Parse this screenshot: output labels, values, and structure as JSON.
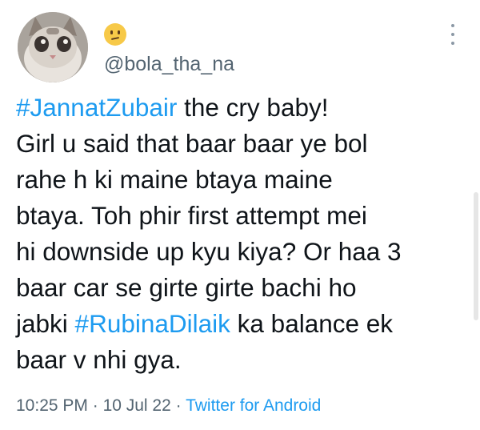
{
  "author": {
    "display_emoji": "😕",
    "handle": "@bola_tha_na"
  },
  "tweet": {
    "lines": [
      [
        {
          "text": "#JannatZubair",
          "hashtag": true
        },
        {
          "text": " the cry baby!",
          "hashtag": false
        }
      ],
      [
        {
          "text": "Girl u said that baar baar ye bol",
          "hashtag": false
        }
      ],
      [
        {
          "text": "rahe h ki maine btaya maine",
          "hashtag": false
        }
      ],
      [
        {
          "text": "btaya. Toh phir first attempt mei",
          "hashtag": false
        }
      ],
      [
        {
          "text": "hi downside up kyu kiya? Or haa 3",
          "hashtag": false
        }
      ],
      [
        {
          "text": "baar car se girte girte bachi ho",
          "hashtag": false
        }
      ],
      [
        {
          "text": "jabki ",
          "hashtag": false
        },
        {
          "text": "#RubinaDilaik",
          "hashtag": true
        },
        {
          "text": " ka balance ek",
          "hashtag": false
        }
      ],
      [
        {
          "text": "baar v nhi gya.",
          "hashtag": false
        }
      ]
    ]
  },
  "meta": {
    "time": "10:25 PM",
    "separator": " · ",
    "date": "10 Jul 22",
    "source": "Twitter for Android"
  },
  "colors": {
    "link": "#1d9bf0",
    "text": "#0f1419",
    "muted": "#536471"
  }
}
